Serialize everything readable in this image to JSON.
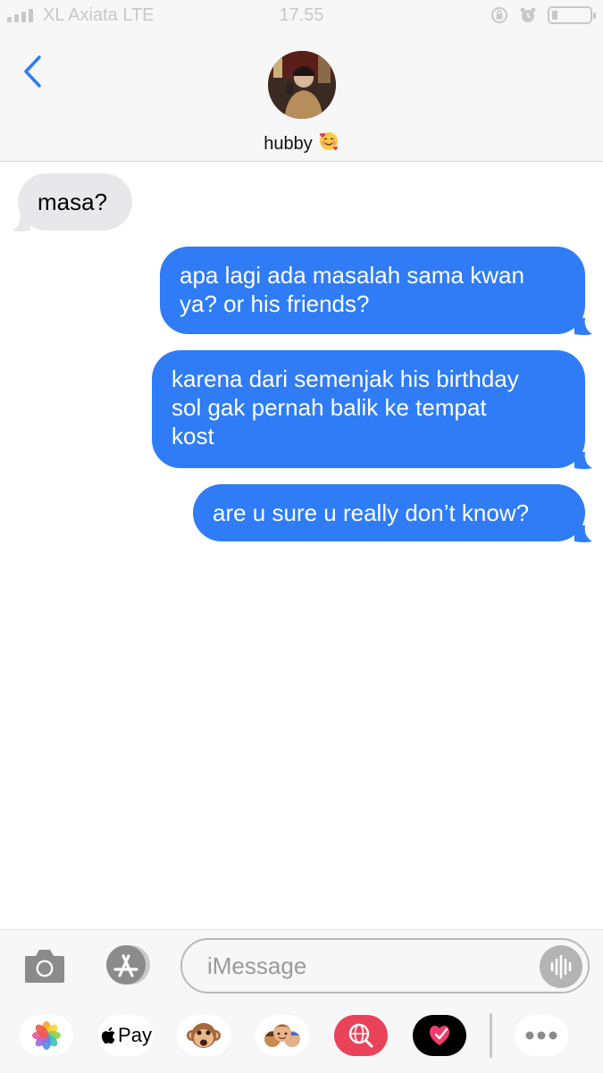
{
  "status_bar": {
    "carrier": "XL Axiata  LTE",
    "time": "17.55",
    "icons": [
      "signal-icon",
      "screen-rotation-lock-icon",
      "alarm-icon",
      "battery-icon"
    ]
  },
  "header": {
    "back_icon": "chevron-left-icon",
    "contact_name": "hubby",
    "contact_emoji": "smiling-face-with-hearts"
  },
  "messages": [
    {
      "direction": "incoming",
      "lines": [
        "masa?"
      ]
    },
    {
      "direction": "outgoing",
      "lines": [
        "apa lagi ada masalah sama kwan",
        "ya? or his friends?"
      ]
    },
    {
      "direction": "outgoing",
      "lines": [
        "karena dari semenjak his birthday",
        "sol gak pernah balik ke tempat",
        "kost"
      ]
    },
    {
      "direction": "outgoing",
      "lines": [
        "are u sure u really don’t know?"
      ]
    }
  ],
  "composer": {
    "placeholder": "iMessage",
    "value": "",
    "camera_icon": "camera-icon",
    "appstore_icon": "app-store-icon",
    "audio_icon": "audio-waveform-icon"
  },
  "app_tray": {
    "items": [
      {
        "name": "photos-app",
        "icon": "photos-flower-icon"
      },
      {
        "name": "apple-pay",
        "label": "Pay",
        "icon": "apple-logo-icon"
      },
      {
        "name": "animoji",
        "icon": "monkey-face-icon"
      },
      {
        "name": "memoji",
        "icon": "memoji-faces-icon"
      },
      {
        "name": "image-search",
        "icon": "globe-search-icon"
      },
      {
        "name": "digital-touch",
        "icon": "heart-touch-icon"
      },
      {
        "name": "more-apps",
        "icon": "more-dots-icon"
      }
    ]
  },
  "colors": {
    "outgoing_bubble": "#2f7cf6",
    "incoming_bubble": "#e8e8ea",
    "accent": "#2f7cf6"
  }
}
